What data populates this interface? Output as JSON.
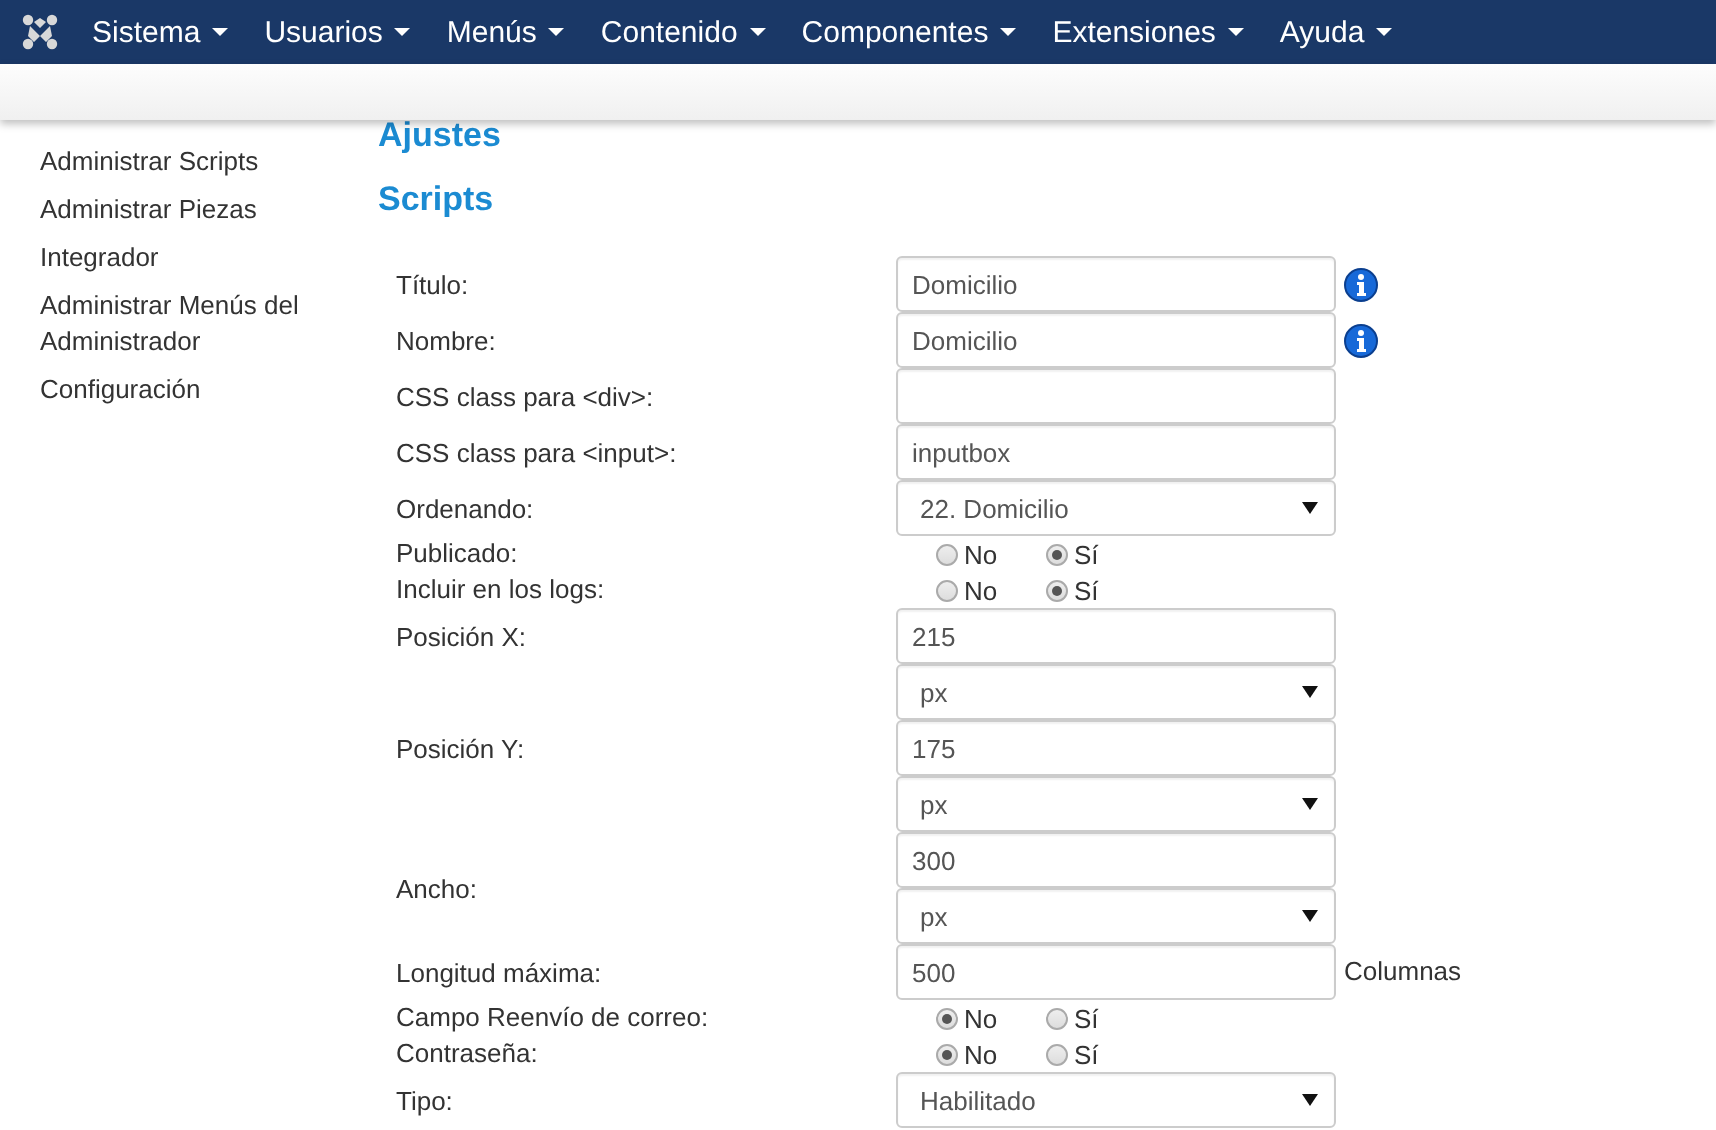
{
  "menu": [
    {
      "label": "Sistema"
    },
    {
      "label": "Usuarios"
    },
    {
      "label": "Menús"
    },
    {
      "label": "Contenido"
    },
    {
      "label": "Componentes"
    },
    {
      "label": "Extensiones"
    },
    {
      "label": "Ayuda"
    }
  ],
  "sidebar": {
    "items": [
      "Administrar Scripts",
      "Administrar Piezas",
      "Integrador",
      "Administrar Menús del Administrador",
      "Configuración"
    ]
  },
  "headings": [
    "Ajustes",
    "Scripts"
  ],
  "form": {
    "rows": [
      {
        "label": "Título:",
        "info": true,
        "controls": [
          {
            "kind": "text",
            "value": "Domicilio"
          }
        ]
      },
      {
        "label": "Nombre:",
        "info": true,
        "controls": [
          {
            "kind": "text",
            "value": "Domicilio"
          }
        ]
      },
      {
        "label": "CSS class para <div>:",
        "controls": [
          {
            "kind": "text"
          }
        ]
      },
      {
        "label": "CSS class para <input>:",
        "controls": [
          {
            "kind": "text",
            "value": "inputbox"
          }
        ]
      },
      {
        "label": "Ordenando:",
        "controls": [
          {
            "kind": "select",
            "value": "22. Domicilio"
          }
        ]
      },
      {
        "label": "Publicado:",
        "controls": [
          {
            "kind": "radio",
            "options": [
              {
                "label": "No",
                "selected": false
              },
              {
                "label": "Sí",
                "selected": true
              }
            ]
          }
        ]
      },
      {
        "label": "Incluir en los logs:",
        "controls": [
          {
            "kind": "radio",
            "options": [
              {
                "label": "No",
                "selected": false
              },
              {
                "label": "Sí",
                "selected": true
              }
            ]
          }
        ]
      },
      {
        "label": "Posición X:",
        "controls": [
          {
            "kind": "text",
            "value": "215"
          },
          {
            "kind": "select",
            "value": "px"
          }
        ]
      },
      {
        "label": "Posición Y:",
        "controls": [
          {
            "kind": "text",
            "value": "175"
          },
          {
            "kind": "select",
            "value": "px"
          }
        ]
      },
      {
        "label": "Ancho:",
        "centered": true,
        "controls": [
          {
            "kind": "text",
            "value": "300"
          },
          {
            "kind": "select",
            "value": "px"
          }
        ]
      },
      {
        "label": "Longitud máxima:",
        "suffix": "Columnas",
        "controls": [
          {
            "kind": "text",
            "value": "500"
          }
        ]
      },
      {
        "label": "Campo Reenvío de correo:",
        "controls": [
          {
            "kind": "radio",
            "options": [
              {
                "label": "No",
                "selected": true
              },
              {
                "label": "Sí",
                "selected": false
              }
            ]
          }
        ]
      },
      {
        "label": "Contraseña:",
        "controls": [
          {
            "kind": "radio",
            "options": [
              {
                "label": "No",
                "selected": true
              },
              {
                "label": "Sí",
                "selected": false
              }
            ]
          }
        ]
      },
      {
        "label": "Tipo:",
        "controls": [
          {
            "kind": "select",
            "value": "Habilitado"
          }
        ]
      }
    ]
  }
}
